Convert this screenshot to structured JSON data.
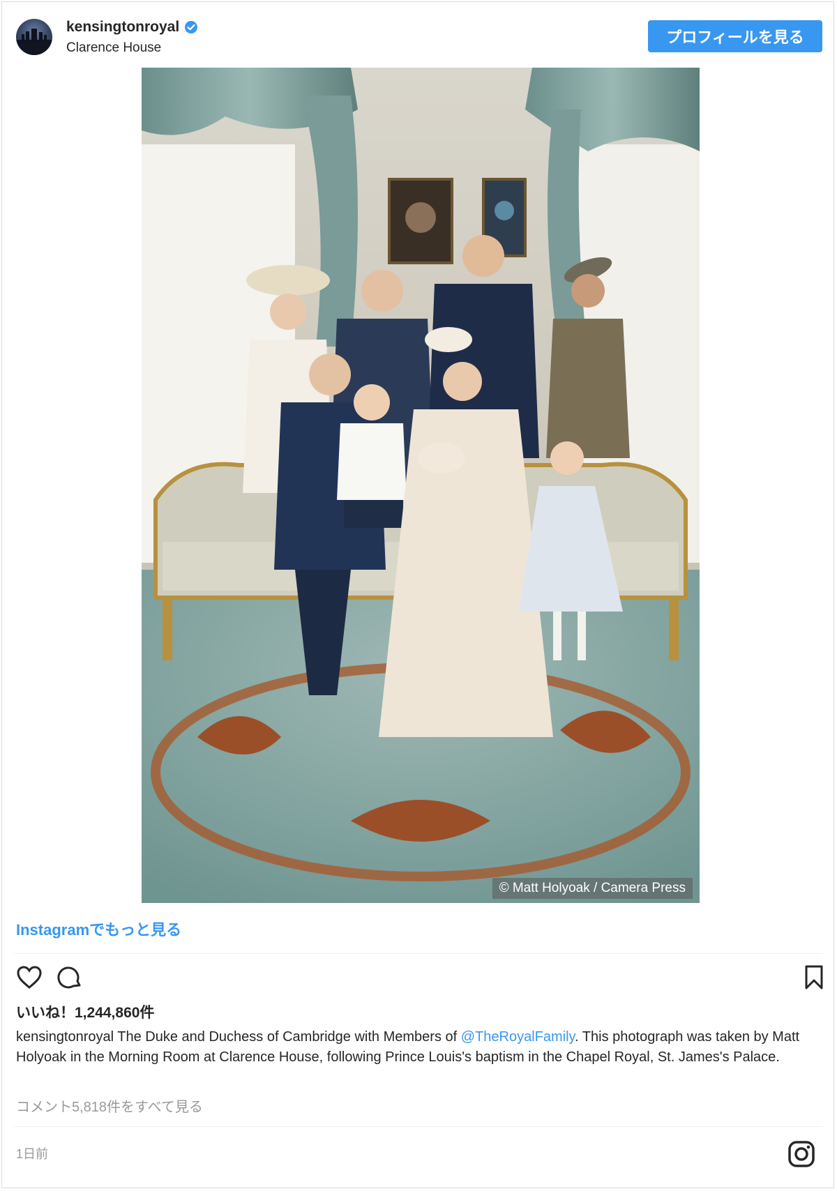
{
  "header": {
    "username": "kensingtonroyal",
    "location": "Clarence House",
    "profile_button": "プロフィールを見る"
  },
  "photo": {
    "credit": "© Matt Holyoak / Camera Press"
  },
  "links": {
    "more_on_instagram": "Instagramでもっと見る"
  },
  "post": {
    "likes": "いいね！1,244,860件",
    "caption_user": "kensingtonroyal",
    "caption_before": " The Duke and Duchess of Cambridge with Members of ",
    "caption_mention": "@TheRoyalFamily",
    "caption_after": ". This photograph was taken by Matt Holyoak in the Morning Room at Clarence House, following Prince Louis's baptism in the Chapel Royal, St. James's Palace.",
    "comments_link": "コメント5,818件をすべて見る",
    "timestamp": "1日前"
  },
  "icons": {
    "verified": "verified-badge-icon",
    "like": "heart-icon",
    "comment": "comment-bubble-icon",
    "save": "bookmark-icon",
    "instagram": "instagram-logo-icon"
  },
  "colors": {
    "accent": "#3897f0",
    "text": "#262626",
    "muted": "#999999"
  }
}
